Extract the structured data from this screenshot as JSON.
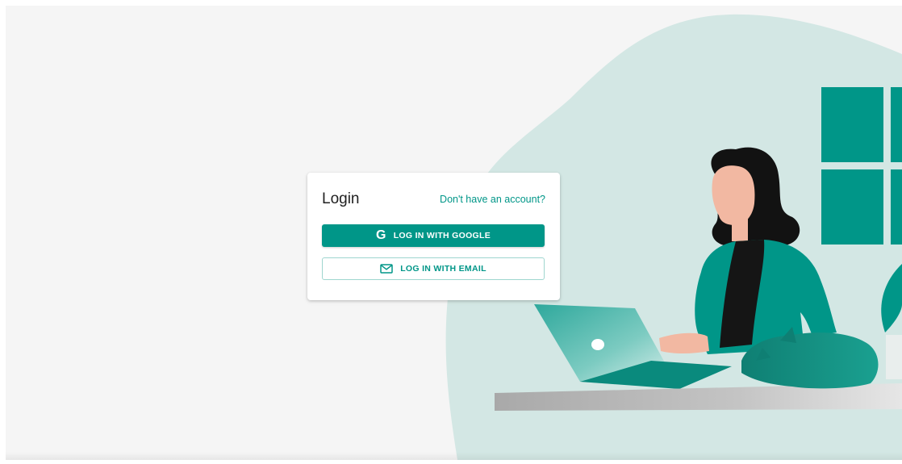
{
  "login": {
    "title": "Login",
    "signup_link": "Don't have an account?",
    "google_button": "LOG IN WITH GOOGLE",
    "email_button": "LOG IN WITH EMAIL"
  },
  "icons": {
    "google": "google-g-icon",
    "email": "envelope-icon"
  },
  "colors": {
    "accent": "#009688",
    "blob": "#d3e7e4",
    "page_background": "#f5f5f5"
  }
}
